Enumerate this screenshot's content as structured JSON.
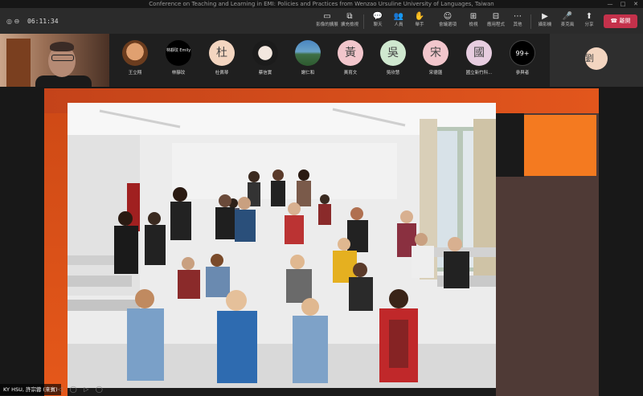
{
  "window": {
    "title": "Conference on Teaching and Learning in EMI: Policies and Practices from Wenzao Ursuline University of Languages, Taiwan",
    "controls": [
      "—",
      "□",
      "✕"
    ]
  },
  "toolbar": {
    "timer": "06:11:34",
    "buttons": [
      {
        "icon": "▭",
        "label": "影像的擴展"
      },
      {
        "icon": "⧉",
        "label": "擴充檢視"
      },
      {
        "icon": "💬",
        "label": "聊天"
      },
      {
        "icon": "👥",
        "label": "人員"
      },
      {
        "icon": "✋",
        "label": "舉手"
      },
      {
        "icon": "☺",
        "label": "會議選項"
      },
      {
        "icon": "⊞",
        "label": "檢視"
      },
      {
        "icon": "⊟",
        "label": "應用程式"
      },
      {
        "icon": "⋯",
        "label": "其他"
      },
      {
        "icon": "▶",
        "label": "攝影機"
      },
      {
        "icon": "🎤",
        "label": "麥克風"
      },
      {
        "icon": "⬆",
        "label": "分享"
      }
    ],
    "leave_label": "離開"
  },
  "participants": [
    {
      "name": "王立翔",
      "initial": "",
      "style": "photo1"
    },
    {
      "name": "林靜玟",
      "initial": "林靜玟 Emily",
      "style": "photo2"
    },
    {
      "name": "杜佩琴",
      "initial": "杜",
      "style": "init"
    },
    {
      "name": "蔡信實",
      "initial": "",
      "style": "photo3"
    },
    {
      "name": "謝仁和",
      "initial": "",
      "style": "photo4"
    },
    {
      "name": "黃育文",
      "initial": "黃",
      "style": "pink"
    },
    {
      "name": "吳欣慧",
      "initial": "吳",
      "style": "green"
    },
    {
      "name": "宋德蓮",
      "initial": "宋",
      "style": "pink"
    },
    {
      "name": "國立新竹科...",
      "initial": "國",
      "style": "lav"
    },
    {
      "name": "參與者",
      "initial": "99+",
      "style": "more"
    }
  ],
  "overflow_tile": {
    "initial": "劉"
  },
  "presenter": {
    "label": "KY HSU, 許宗蓉 (來賓)"
  },
  "colors": {
    "leave": "#c4314b",
    "slide_orange": "#f47a20",
    "slide_band": "#e2561c"
  }
}
